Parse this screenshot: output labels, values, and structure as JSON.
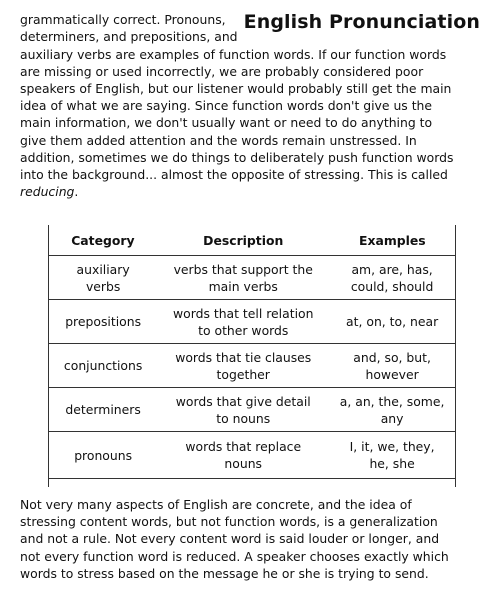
{
  "header": {
    "title": "English Pronunciation"
  },
  "intro": {
    "line1": "grammatically correct. Pronouns,",
    "line2": "determiners, and prepositions, and",
    "lines": [
      "auxiliary verbs are examples of function words. If our function words",
      "are missing or used incorrectly, we are probably considered poor",
      "speakers of English, but our listener would probably still get the main",
      "idea of what we are saying. Since function words don't give us the",
      "main information, we don't usually want or need to do anything to",
      "give them added attention and the words remain unstressed. In",
      "addition, sometimes we do things to deliberately push function words",
      "into the background... almost the opposite of stressing. This is called"
    ],
    "last_word": "reducing",
    "last_punct": "."
  },
  "table": {
    "headers": {
      "category": "Category",
      "description": "Description",
      "examples": "Examples"
    },
    "rows": [
      {
        "category": [
          "auxiliary",
          "verbs"
        ],
        "description": [
          "verbs that support the",
          "main verbs"
        ],
        "examples": [
          "am, are, has,",
          "could, should"
        ]
      },
      {
        "category": [
          "prepositions"
        ],
        "description": [
          "words that tell relation",
          "to other words"
        ],
        "examples": [
          "at, on, to, near"
        ]
      },
      {
        "category": [
          "conjunctions"
        ],
        "description": [
          "words that tie clauses",
          "together"
        ],
        "examples": [
          "and, so, but,",
          "however"
        ]
      },
      {
        "category": [
          "determiners"
        ],
        "description": [
          "words that give detail",
          "to nouns"
        ],
        "examples": [
          "a, an, the, some,",
          "any"
        ]
      },
      {
        "category": [
          "pronouns"
        ],
        "description": [
          "words that replace",
          "nouns"
        ],
        "examples": [
          "I, it, we, they,",
          "he, she"
        ]
      }
    ]
  },
  "closing": {
    "lines": [
      "Not very many aspects of English are concrete, and the idea of",
      "stressing content words, but not function words, is a generalization",
      "and not a rule. Not every content word is said louder or longer, and",
      "not every function word is reduced. A speaker chooses exactly which",
      "words to stress based on the message he or she is trying to send."
    ]
  }
}
